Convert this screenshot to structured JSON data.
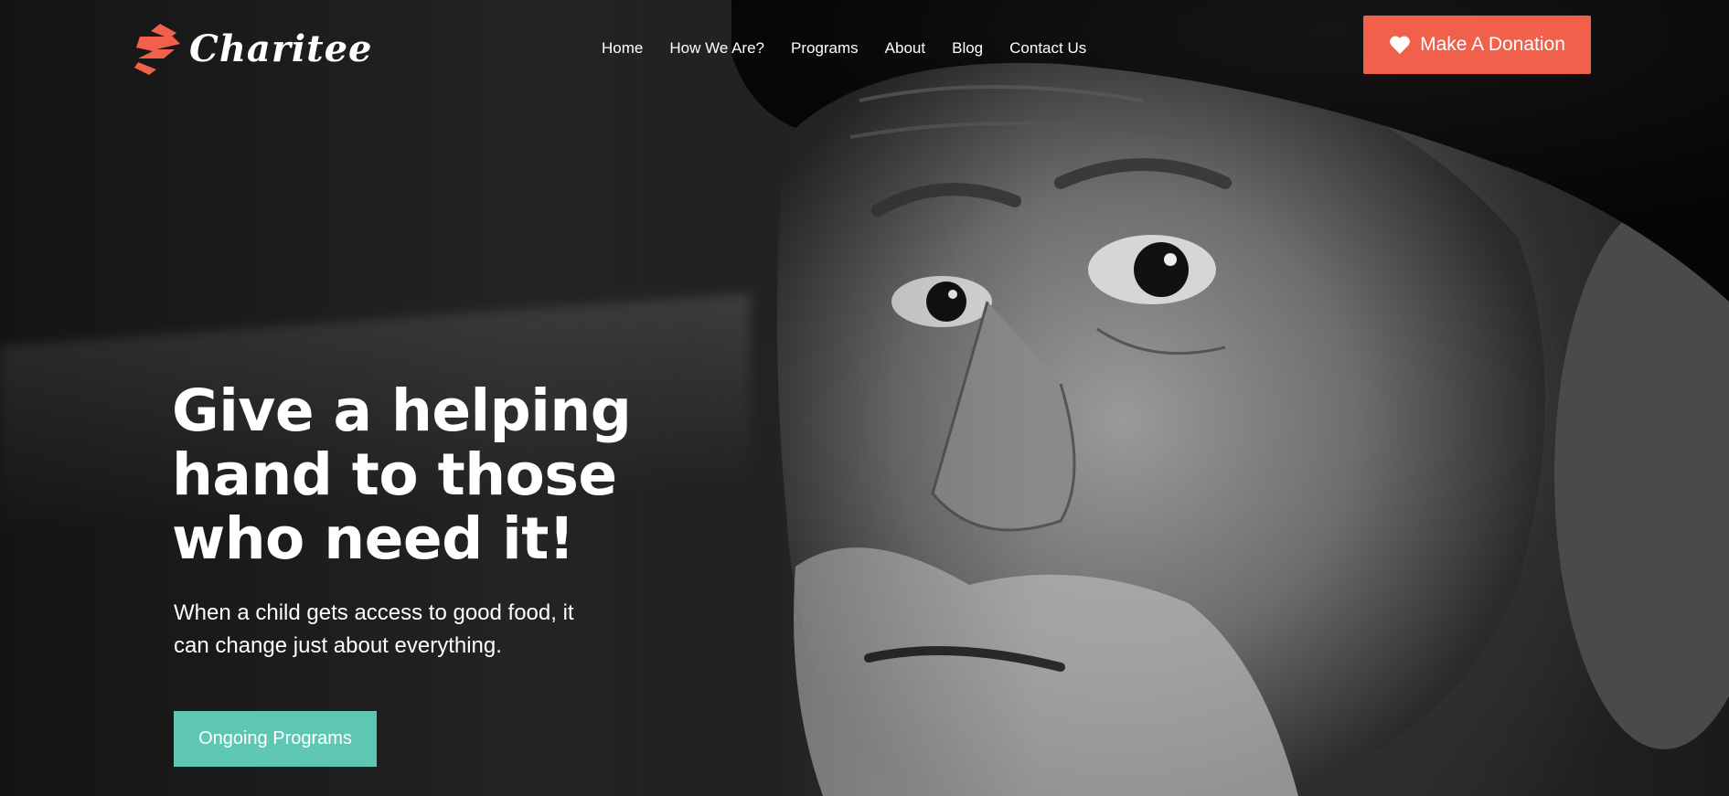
{
  "brand": {
    "name": "Charitee",
    "accent": "#f0604a",
    "secondary": "#5ec7b3",
    "logo_icon": "charitee-logo-icon"
  },
  "nav": {
    "items": [
      {
        "label": "Home"
      },
      {
        "label": "How We Are?"
      },
      {
        "label": "Programs"
      },
      {
        "label": "About"
      },
      {
        "label": "Blog"
      },
      {
        "label": "Contact Us"
      }
    ]
  },
  "donate": {
    "label": "Make A Donation",
    "icon": "heart-icon"
  },
  "hero": {
    "title": "Give a helping hand to those who need it!",
    "subtitle": "When a child gets access to good food, it can change just about everything.",
    "cta_label": "Ongoing Programs",
    "image": "hero-portrait-image"
  }
}
